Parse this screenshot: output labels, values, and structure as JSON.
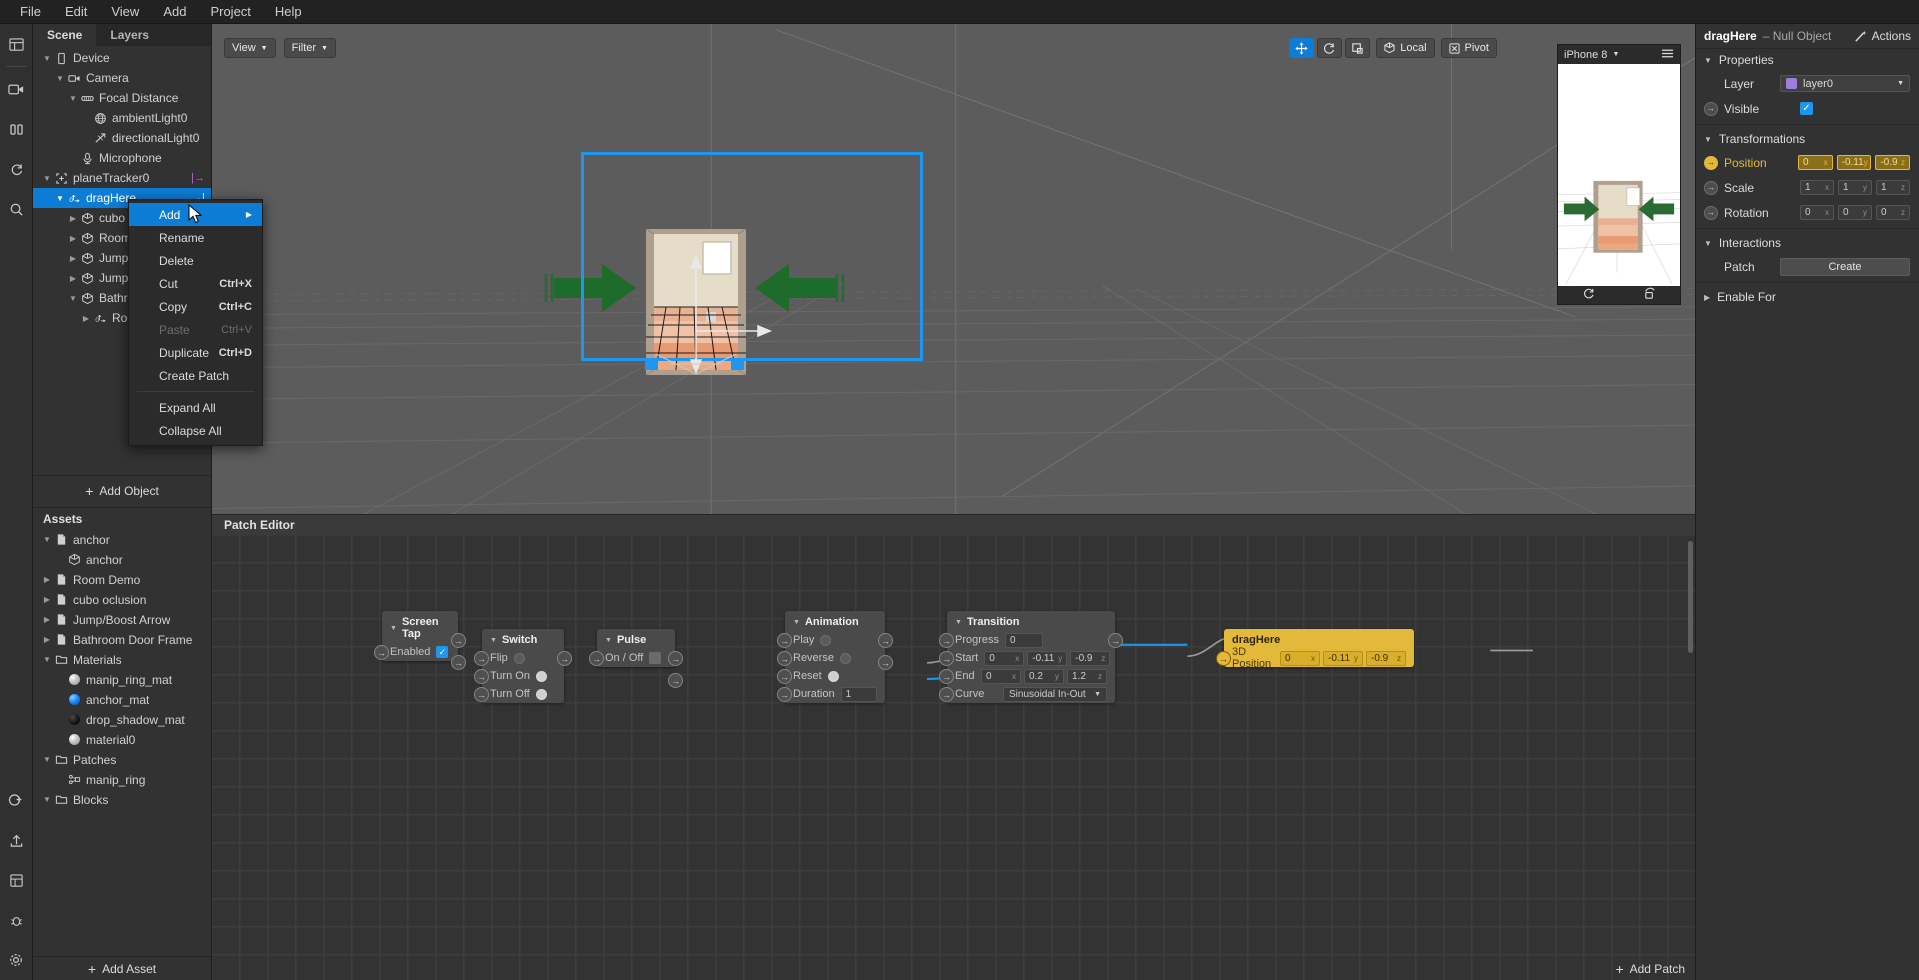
{
  "menubar": [
    "File",
    "Edit",
    "View",
    "Add",
    "Project",
    "Help"
  ],
  "rail": [
    {
      "name": "layout-icon"
    },
    {
      "name": "video-camera-icon"
    },
    {
      "name": "pause-icon"
    },
    {
      "name": "refresh-icon"
    },
    {
      "name": "search-icon"
    },
    {
      "name": "add-circle-icon"
    },
    {
      "name": "upload-icon"
    },
    {
      "name": "grid-icon"
    },
    {
      "name": "bug-icon"
    },
    {
      "name": "gear-icon"
    }
  ],
  "left_panel": {
    "tabs": [
      {
        "label": "Scene",
        "active": true
      },
      {
        "label": "Layers",
        "active": false
      }
    ],
    "scene_tree": [
      {
        "label": "Device",
        "depth": 0,
        "twisty": "down",
        "icon": "device-icon",
        "selected": false,
        "trail": ""
      },
      {
        "label": "Camera",
        "depth": 1,
        "twisty": "down",
        "icon": "camera-icon",
        "selected": false,
        "trail": ""
      },
      {
        "label": "Focal Distance",
        "depth": 2,
        "twisty": "down",
        "icon": "focal-icon",
        "selected": false,
        "trail": ""
      },
      {
        "label": "ambientLight0",
        "depth": 3,
        "twisty": "none",
        "icon": "globe-icon",
        "selected": false,
        "trail": ""
      },
      {
        "label": "directionalLight0",
        "depth": 3,
        "twisty": "none",
        "icon": "directional-light-icon",
        "selected": false,
        "trail": ""
      },
      {
        "label": "Microphone",
        "depth": 2,
        "twisty": "none",
        "icon": "microphone-icon",
        "selected": false,
        "trail": ""
      },
      {
        "label": "planeTracker0",
        "depth": 0,
        "twisty": "down",
        "icon": "plane-tracker-icon",
        "selected": false,
        "trail": "|→"
      },
      {
        "label": "dragHere",
        "depth": 1,
        "twisty": "down",
        "icon": "null-object-icon",
        "selected": true,
        "trail": "→|"
      },
      {
        "label": "cubo oclusion",
        "depth": 2,
        "twisty": "right",
        "icon": "mesh-icon",
        "selected": false,
        "trail": ""
      },
      {
        "label": "Room Demo",
        "depth": 2,
        "twisty": "right",
        "icon": "mesh-icon",
        "selected": false,
        "trail": ""
      },
      {
        "label": "Jump/Boost Arrow",
        "depth": 2,
        "twisty": "right",
        "icon": "mesh-icon",
        "selected": false,
        "trail": ""
      },
      {
        "label": "Jump/Boost Arrow",
        "depth": 2,
        "twisty": "right",
        "icon": "mesh-icon",
        "selected": false,
        "trail": ""
      },
      {
        "label": "Bathroom Door Frame",
        "depth": 2,
        "twisty": "down",
        "icon": "mesh-icon",
        "selected": false,
        "trail": ""
      },
      {
        "label": "RootNode",
        "depth": 3,
        "twisty": "right",
        "icon": "null-object-icon",
        "selected": false,
        "trail": ""
      }
    ],
    "add_object_label": "Add Object",
    "assets_title": "Assets",
    "assets": [
      {
        "label": "anchor",
        "depth": 0,
        "twisty": "down",
        "icon": "file-icon"
      },
      {
        "label": "anchor",
        "depth": 1,
        "twisty": "none",
        "icon": "mesh-icon"
      },
      {
        "label": "Room Demo",
        "depth": 0,
        "twisty": "right",
        "icon": "file-icon"
      },
      {
        "label": "cubo oclusion",
        "depth": 0,
        "twisty": "right",
        "icon": "file-icon"
      },
      {
        "label": "Jump/Boost Arrow",
        "depth": 0,
        "twisty": "right",
        "icon": "file-icon"
      },
      {
        "label": "Bathroom Door Frame",
        "depth": 0,
        "twisty": "right",
        "icon": "file-icon"
      },
      {
        "label": "Materials",
        "depth": 0,
        "twisty": "down",
        "icon": "folder-icon"
      },
      {
        "label": "manip_ring_mat",
        "depth": 1,
        "twisty": "none",
        "icon": "material-sphere-icon"
      },
      {
        "label": "anchor_mat",
        "depth": 1,
        "twisty": "none",
        "icon": "material-sphere-blue-icon"
      },
      {
        "label": "drop_shadow_mat",
        "depth": 1,
        "twisty": "none",
        "icon": "material-sphere-black-icon"
      },
      {
        "label": "material0",
        "depth": 1,
        "twisty": "none",
        "icon": "material-sphere-icon"
      },
      {
        "label": "Patches",
        "depth": 0,
        "twisty": "down",
        "icon": "folder-icon"
      },
      {
        "label": "manip_ring",
        "depth": 1,
        "twisty": "none",
        "icon": "patch-icon"
      },
      {
        "label": "Blocks",
        "depth": 0,
        "twisty": "down",
        "icon": "folder-icon"
      }
    ],
    "add_asset_label": "Add Asset"
  },
  "context_menu": {
    "items": [
      {
        "label": "Add",
        "shortcut": "",
        "highlight": true,
        "disabled": false,
        "submenu": true
      },
      {
        "label": "Rename",
        "shortcut": "",
        "highlight": false,
        "disabled": false,
        "submenu": false
      },
      {
        "label": "Delete",
        "shortcut": "",
        "highlight": false,
        "disabled": false,
        "submenu": false
      },
      {
        "label": "Cut",
        "shortcut": "Ctrl+X",
        "highlight": false,
        "disabled": false,
        "submenu": false
      },
      {
        "label": "Copy",
        "shortcut": "Ctrl+C",
        "highlight": false,
        "disabled": false,
        "submenu": false
      },
      {
        "label": "Paste",
        "shortcut": "Ctrl+V",
        "highlight": false,
        "disabled": true,
        "submenu": false
      },
      {
        "label": "Duplicate",
        "shortcut": "Ctrl+D",
        "highlight": false,
        "disabled": false,
        "submenu": false
      },
      {
        "label": "Create Patch",
        "shortcut": "",
        "highlight": false,
        "disabled": false,
        "submenu": false
      },
      {
        "label": "Expand All",
        "shortcut": "",
        "highlight": false,
        "disabled": false,
        "submenu": false
      },
      {
        "label": "Collapse All",
        "shortcut": "",
        "highlight": false,
        "disabled": false,
        "submenu": false
      }
    ],
    "separator_after_index": 7
  },
  "viewport": {
    "view_label": "View",
    "filter_label": "Filter",
    "local_label": "Local",
    "pivot_label": "Pivot",
    "tools": [
      {
        "name": "move-tool",
        "glyph": "✥",
        "active": true
      },
      {
        "name": "rotate-tool",
        "glyph": "↺",
        "active": false
      },
      {
        "name": "scale-tool",
        "glyph": "⧉",
        "active": false
      }
    ]
  },
  "device_preview": {
    "device": "iPhone 8",
    "menu_icon": "hamburger-icon",
    "reload_icon": "reload-icon",
    "record_icon": "record-icon"
  },
  "patch_editor": {
    "title": "Patch Editor",
    "add_patch_label": "Add Patch",
    "nodes": [
      {
        "id": "screen-tap",
        "title": "Screen Tap",
        "rows": [
          {
            "label": "Enabled",
            "control": "checkbox",
            "value": "true"
          }
        ]
      },
      {
        "id": "switch",
        "title": "Switch",
        "rows": [
          {
            "label": "Flip",
            "control": "dot",
            "value": "off"
          },
          {
            "label": "Turn On",
            "control": "dot",
            "value": "on"
          },
          {
            "label": "Turn Off",
            "control": "dot",
            "value": "on"
          }
        ]
      },
      {
        "id": "pulse",
        "title": "Pulse",
        "rows": [
          {
            "label": "On / Off",
            "control": "box",
            "value": ""
          }
        ]
      },
      {
        "id": "animation",
        "title": "Animation",
        "rows": [
          {
            "label": "Play",
            "control": "dot",
            "value": "off"
          },
          {
            "label": "Reverse",
            "control": "dot",
            "value": "off"
          },
          {
            "label": "Reset",
            "control": "dot",
            "value": "on"
          },
          {
            "label": "Duration",
            "control": "number",
            "value": "1"
          }
        ]
      },
      {
        "id": "transition",
        "title": "Transition",
        "rows": [
          {
            "label": "Progress",
            "control": "number",
            "value": "0"
          },
          {
            "label": "Start",
            "control": "vec3",
            "value": [
              "0",
              "-0.11",
              "-0.9"
            ]
          },
          {
            "label": "End",
            "control": "vec3",
            "value": [
              "0",
              "0.2",
              "1.2"
            ]
          },
          {
            "label": "Curve",
            "control": "select",
            "value": "Sinusoidal In-Out"
          }
        ]
      },
      {
        "id": "draghere",
        "title": "dragHere",
        "yellow": true,
        "rows": [
          {
            "label": "3D Position",
            "control": "vec3",
            "value": [
              "0",
              "-0.11",
              "-0.9"
            ]
          }
        ]
      }
    ],
    "axes": [
      "x",
      "y",
      "z"
    ]
  },
  "inspector": {
    "object_name": "dragHere",
    "object_type": "– Null Object",
    "actions_label": "Actions",
    "sections": {
      "properties": "Properties",
      "transformations": "Transformations",
      "interactions": "Interactions",
      "enable_for": "Enable For"
    },
    "layer_label": "Layer",
    "layer_value": "layer0",
    "layer_color": "#9a7fe0",
    "visible_label": "Visible",
    "visible_checked": true,
    "position_label": "Position",
    "position": [
      "0",
      "-0.11",
      "-0.9"
    ],
    "scale_label": "Scale",
    "scale": [
      "1",
      "1",
      "1"
    ],
    "rotation_label": "Rotation",
    "rotation": [
      "0",
      "0",
      "0"
    ],
    "axes": [
      "x",
      "y",
      "z"
    ],
    "patch_label": "Patch",
    "create_label": "Create",
    "accent_yellow": "#e2b93b",
    "accent_blue": "#1e97f0"
  }
}
